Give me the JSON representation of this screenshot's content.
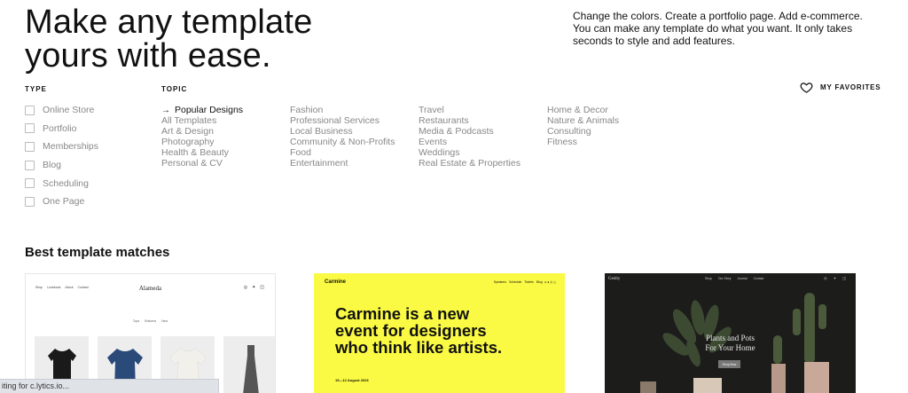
{
  "hero": {
    "title_line1": "Make any template",
    "title_line2": "yours with ease.",
    "description": "Change the colors. Create a portfolio page. Add e-commerce. You can make any template do what you want. It only takes seconds to style and add features."
  },
  "filters": {
    "type_heading": "TYPE",
    "types": [
      "Online Store",
      "Portfolio",
      "Memberships",
      "Blog",
      "Scheduling",
      "One Page"
    ],
    "topic_heading": "TOPIC",
    "topic_columns": [
      [
        "Popular Designs",
        "All Templates",
        "Art & Design",
        "Photography",
        "Health & Beauty",
        "Personal & CV"
      ],
      [
        "Fashion",
        "Professional Services",
        "Local Business",
        "Community & Non-Profits",
        "Food",
        "Entertainment"
      ],
      [
        "Travel",
        "Restaurants",
        "Media & Podcasts",
        "Events",
        "Weddings",
        "Real Estate & Properties"
      ],
      [
        "Home & Decor",
        "Nature & Animals",
        "Consulting",
        "Fitness"
      ]
    ],
    "active_topic": "Popular Designs"
  },
  "favorites": {
    "label": "MY FAVORITES",
    "icon": "heart-icon"
  },
  "matches": {
    "title": "Best template matches",
    "cards": [
      {
        "name": "Alameda",
        "nav": [
          "Shop",
          "Lookbook",
          "About",
          "Contact"
        ],
        "filters": [
          "Tops",
          "Bottoms",
          "New"
        ],
        "background": "#ffffff"
      },
      {
        "name": "Carmine",
        "nav": [
          "Speakers",
          "Schedule",
          "Tickets",
          "Blog"
        ],
        "headline": "Carmine is a new event for designers who think like artists.",
        "date": "19—12 August 2023",
        "background": "#fafa44"
      },
      {
        "name": "Geuby",
        "nav": [
          "Shop",
          "Our Story",
          "Journal",
          "Contact"
        ],
        "headline_line1": "Plants and Pots",
        "headline_line2": "For Your Home",
        "button": "Shop Now",
        "background": "#1c1c1a"
      }
    ]
  },
  "status": {
    "text": "iting for c.lytics.io..."
  }
}
